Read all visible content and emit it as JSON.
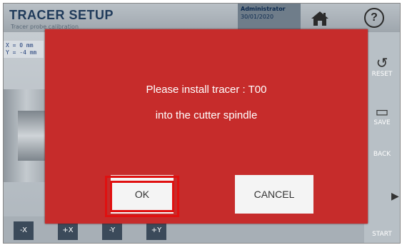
{
  "app": {
    "title": "TRACER SETUP",
    "subtitle": "Tracer probe calibration",
    "user_role": "Administrator",
    "date": "30/01/2020"
  },
  "coords": {
    "x_line": "X = 0 mm",
    "y_line": "Y = -4 mm"
  },
  "header": {
    "help_label": "?"
  },
  "side_buttons": {
    "reset": "RESET",
    "save": "SAVE",
    "back": "BACK",
    "start": "START"
  },
  "jog_buttons": [
    "-X",
    "+X",
    "-Y",
    "+Y"
  ],
  "dialog": {
    "line1": "Please install tracer : T00",
    "line2": "into the cutter spindle",
    "ok_label": "OK",
    "cancel_label": "CANCEL",
    "background_color": "#c62c2b"
  }
}
